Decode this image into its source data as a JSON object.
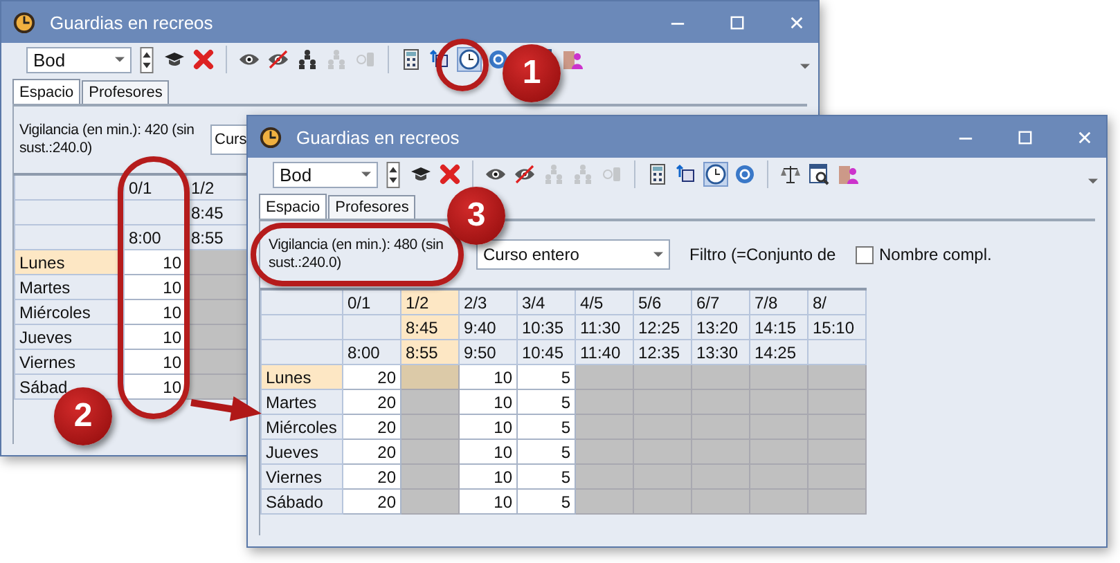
{
  "windows": [
    {
      "title": "Guardias en recreos",
      "combo": "Bod",
      "tool_groups": [
        [
          {
            "kind": "cap",
            "disabled": false,
            "selected": false
          },
          {
            "kind": "delete",
            "disabled": false,
            "selected": false
          }
        ],
        [
          {
            "kind": "eye",
            "disabled": false,
            "selected": false
          },
          {
            "kind": "eye-off",
            "disabled": false,
            "selected": false
          },
          {
            "kind": "tree",
            "disabled": false,
            "selected": false
          },
          {
            "kind": "tree",
            "disabled": true,
            "selected": false
          },
          {
            "kind": "plug",
            "disabled": true,
            "selected": false
          }
        ],
        [
          {
            "kind": "calc",
            "disabled": false,
            "selected": false
          },
          {
            "kind": "rotate",
            "disabled": false,
            "selected": false
          },
          {
            "kind": "clock",
            "disabled": false,
            "selected": true
          },
          {
            "kind": "refresh",
            "disabled": false,
            "selected": false
          }
        ],
        [
          {
            "kind": "report",
            "disabled": false,
            "selected": false
          },
          {
            "kind": "person",
            "disabled": false,
            "selected": false
          }
        ]
      ],
      "tabs": [
        {
          "label": "Espacio",
          "selected": true
        },
        {
          "label": "Profesores",
          "selected": false
        }
      ],
      "summary": "Vigilancia (en min.): 420 (sin sust.:240.0)",
      "course": "Curs",
      "columns": [
        {
          "label": "0/1",
          "end": "8:00",
          "selected": false
        },
        {
          "label": "1/2",
          "start": "8:45",
          "end": "8:55",
          "selected": false
        }
      ],
      "rows": [
        {
          "day": "Lunes",
          "selected": true,
          "cells": [
            {
              "value": "10",
              "blocked": false
            },
            {
              "blocked": true
            }
          ]
        },
        {
          "day": "Martes",
          "selected": false,
          "cells": [
            {
              "value": "10",
              "blocked": false
            },
            {
              "blocked": true
            }
          ]
        },
        {
          "day": "Miércoles",
          "selected": false,
          "cells": [
            {
              "value": "10",
              "blocked": false
            },
            {
              "blocked": true
            }
          ]
        },
        {
          "day": "Jueves",
          "selected": false,
          "cells": [
            {
              "value": "10",
              "blocked": false
            },
            {
              "blocked": true
            }
          ]
        },
        {
          "day": "Viernes",
          "selected": false,
          "cells": [
            {
              "value": "10",
              "blocked": false
            },
            {
              "blocked": true
            }
          ]
        },
        {
          "day": "Sábad",
          "selected": false,
          "cells": [
            {
              "value": "10",
              "blocked": false
            },
            {
              "blocked": true
            }
          ]
        }
      ]
    },
    {
      "title": "Guardias en recreos",
      "combo": "Bod",
      "tool_groups": [
        [
          {
            "kind": "cap",
            "disabled": false,
            "selected": false
          },
          {
            "kind": "delete",
            "disabled": false,
            "selected": false
          }
        ],
        [
          {
            "kind": "eye",
            "disabled": false,
            "selected": false
          },
          {
            "kind": "eye-off",
            "disabled": false,
            "selected": false
          },
          {
            "kind": "tree",
            "disabled": true,
            "selected": false
          },
          {
            "kind": "tree",
            "disabled": true,
            "selected": false
          },
          {
            "kind": "plug",
            "disabled": true,
            "selected": false
          }
        ],
        [
          {
            "kind": "calc",
            "disabled": false,
            "selected": false
          },
          {
            "kind": "rotate",
            "disabled": false,
            "selected": false
          },
          {
            "kind": "clock",
            "disabled": false,
            "selected": true
          },
          {
            "kind": "refresh",
            "disabled": false,
            "selected": false
          }
        ],
        [
          {
            "kind": "scales",
            "disabled": false,
            "selected": false
          },
          {
            "kind": "report",
            "disabled": false,
            "selected": false
          },
          {
            "kind": "person",
            "disabled": false,
            "selected": false
          }
        ]
      ],
      "tabs": [
        {
          "label": "Espacio",
          "selected": true
        },
        {
          "label": "Profesores",
          "selected": false
        }
      ],
      "summary": "Vigilancia (en min.): 480 (sin sust.:240.0)",
      "course": "Curso entero",
      "filter_label": "Filtro (=Conjunto de",
      "full_names": {
        "label": "Nombre compl.",
        "checked": false
      },
      "columns": [
        {
          "label": "0/1",
          "end": "8:00",
          "selected": false
        },
        {
          "label": "1/2",
          "start": "8:45",
          "end": "8:55",
          "selected": true
        },
        {
          "label": "2/3",
          "start": "9:40",
          "end": "9:50",
          "selected": false
        },
        {
          "label": "3/4",
          "start": "10:35",
          "end": "10:45",
          "selected": false
        },
        {
          "label": "4/5",
          "start": "11:30",
          "end": "11:40",
          "selected": false
        },
        {
          "label": "5/6",
          "start": "12:25",
          "end": "12:35",
          "selected": false
        },
        {
          "label": "6/7",
          "start": "13:20",
          "end": "13:30",
          "selected": false
        },
        {
          "label": "7/8",
          "start": "14:15",
          "end": "14:25",
          "selected": false
        },
        {
          "label": "8/",
          "start": "15:10",
          "selected": false
        }
      ],
      "rows": [
        {
          "day": "Lunes",
          "selected": true,
          "cells": [
            {
              "value": "20",
              "blocked": false
            },
            {
              "blocked": true
            },
            {
              "value": "10",
              "blocked": false
            },
            {
              "value": "5",
              "blocked": false
            },
            {
              "blocked": true
            },
            {
              "blocked": true
            },
            {
              "blocked": true
            },
            {
              "blocked": true
            },
            {
              "blocked": true
            }
          ]
        },
        {
          "day": "Martes",
          "selected": false,
          "cells": [
            {
              "value": "20",
              "blocked": false
            },
            {
              "blocked": true
            },
            {
              "value": "10",
              "blocked": false
            },
            {
              "value": "5",
              "blocked": false
            },
            {
              "blocked": true
            },
            {
              "blocked": true
            },
            {
              "blocked": true
            },
            {
              "blocked": true
            },
            {
              "blocked": true
            }
          ]
        },
        {
          "day": "Miércoles",
          "selected": false,
          "cells": [
            {
              "value": "20",
              "blocked": false
            },
            {
              "blocked": true
            },
            {
              "value": "10",
              "blocked": false
            },
            {
              "value": "5",
              "blocked": false
            },
            {
              "blocked": true
            },
            {
              "blocked": true
            },
            {
              "blocked": true
            },
            {
              "blocked": true
            },
            {
              "blocked": true
            }
          ]
        },
        {
          "day": "Jueves",
          "selected": false,
          "cells": [
            {
              "value": "20",
              "blocked": false
            },
            {
              "blocked": true
            },
            {
              "value": "10",
              "blocked": false
            },
            {
              "value": "5",
              "blocked": false
            },
            {
              "blocked": true
            },
            {
              "blocked": true
            },
            {
              "blocked": true
            },
            {
              "blocked": true
            },
            {
              "blocked": true
            }
          ]
        },
        {
          "day": "Viernes",
          "selected": false,
          "cells": [
            {
              "value": "20",
              "blocked": false
            },
            {
              "blocked": true
            },
            {
              "value": "10",
              "blocked": false
            },
            {
              "value": "5",
              "blocked": false
            },
            {
              "blocked": true
            },
            {
              "blocked": true
            },
            {
              "blocked": true
            },
            {
              "blocked": true
            },
            {
              "blocked": true
            }
          ]
        },
        {
          "day": "Sábado",
          "selected": false,
          "cells": [
            {
              "value": "20",
              "blocked": false
            },
            {
              "blocked": true
            },
            {
              "value": "10",
              "blocked": false
            },
            {
              "value": "5",
              "blocked": false
            },
            {
              "blocked": true
            },
            {
              "blocked": true
            },
            {
              "blocked": true
            },
            {
              "blocked": true
            },
            {
              "blocked": true
            }
          ]
        }
      ]
    }
  ],
  "callouts": [
    {
      "number": "1"
    },
    {
      "number": "2"
    },
    {
      "number": "3"
    }
  ]
}
